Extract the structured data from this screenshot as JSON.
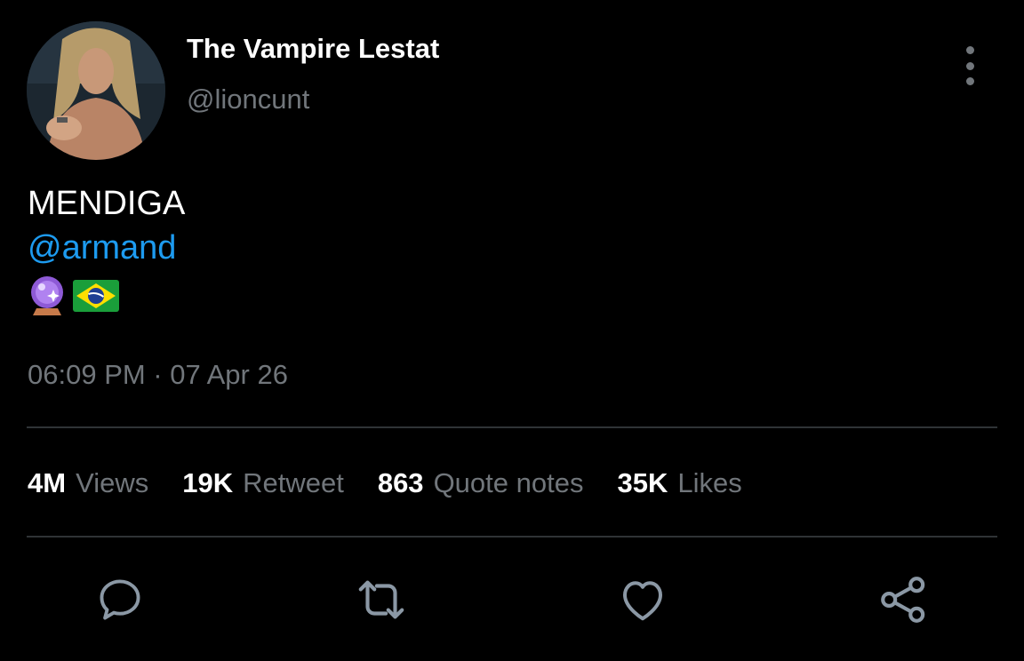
{
  "tweet": {
    "author": {
      "display_name": "The Vampire Lestat",
      "handle": "@lioncunt",
      "avatar_icon": "profile-photo"
    },
    "text": "MENDIGA",
    "mention": "@armand",
    "emojis": [
      "crystal-ball-emoji",
      "brazil-flag-emoji"
    ],
    "timestamp": "06:09 PM · 07 Apr 26",
    "stats": [
      {
        "value": "4M",
        "label": "Views"
      },
      {
        "value": "19K",
        "label": "Retweet"
      },
      {
        "value": "863",
        "label": "Quote notes"
      },
      {
        "value": "35K",
        "label": "Likes"
      }
    ],
    "actions": [
      "reply-icon",
      "retweet-icon",
      "like-icon",
      "share-icon"
    ]
  },
  "colors": {
    "background": "#000000",
    "primary_text": "#ffffff",
    "secondary_text": "#71767b",
    "link": "#1d9bf0",
    "divider": "#2f3336"
  }
}
